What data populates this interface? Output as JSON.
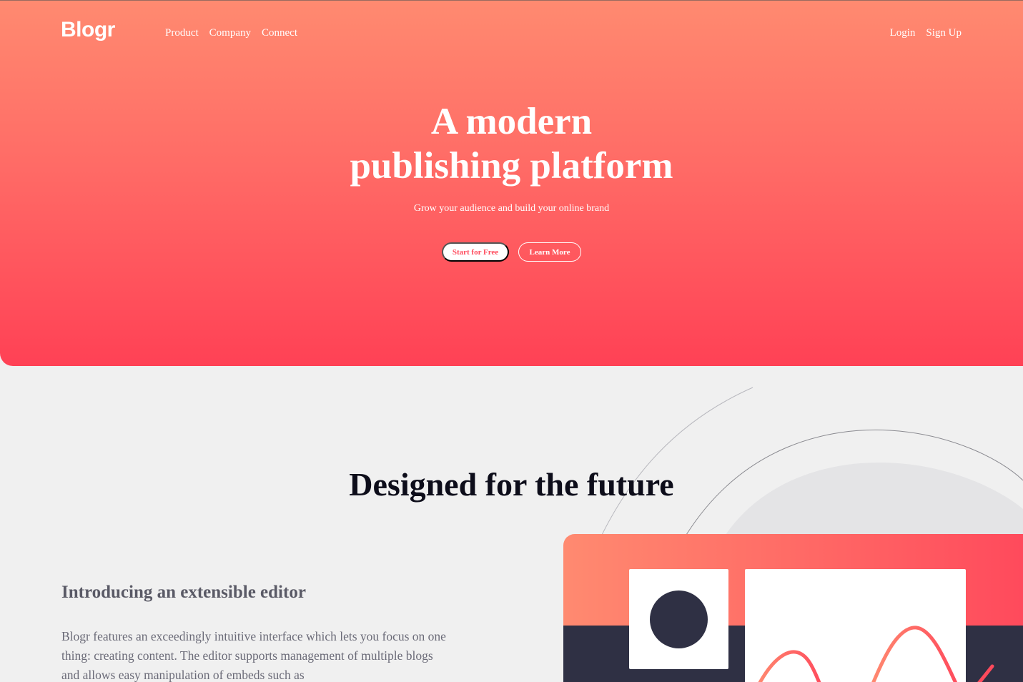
{
  "brand": {
    "logo": "Blogr"
  },
  "nav": {
    "links": [
      "Product",
      "Company",
      "Connect"
    ],
    "login": "Login",
    "signup": "Sign Up"
  },
  "hero": {
    "title_line1": "A modern",
    "title_line2": "publishing platform",
    "subtitle": "Grow your audience and build your online brand",
    "cta_primary": "Start for Free",
    "cta_secondary": "Learn More"
  },
  "features": {
    "section_title": "Designed for the future",
    "heading": "Introducing an extensible editor",
    "body": "Blogr features an exceedingly intuitive interface which lets you focus on one thing: creating content. The editor supports management of multiple blogs and allows easy manipulation of embeds such as"
  },
  "colors": {
    "hero_top": "#ff8a70",
    "hero_bottom": "#ff4155",
    "dark": "#2f3044",
    "heading_dark": "#0d0d1a",
    "body_gray": "#6b6b78"
  }
}
